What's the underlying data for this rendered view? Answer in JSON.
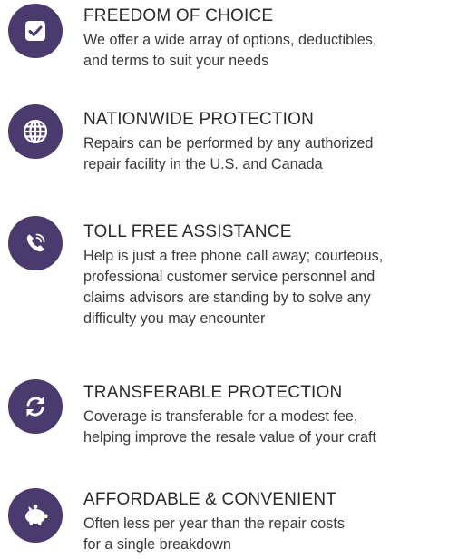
{
  "features": [
    {
      "icon": "checkbox-icon",
      "title": "FREEDOM OF CHOICE",
      "description": "We offer a wide array of options, deductibles,\nand terms to suit your needs"
    },
    {
      "icon": "globe-icon",
      "title": "NATIONWIDE PROTECTION",
      "description": "Repairs can be performed by any authorized\nrepair facility in the U.S. and Canada"
    },
    {
      "icon": "phone-icon",
      "title": "TOLL FREE ASSISTANCE",
      "description": "Help is just a free phone call away; courteous,\nprofessional customer service personnel and\nclaims advisors are standing by to solve any\ndifficulty you may encounter"
    },
    {
      "icon": "transfer-arrows-icon",
      "title": "TRANSFERABLE PROTECTION",
      "description": "Coverage is transferable for a modest fee,\nhelping improve the resale value of your craft"
    },
    {
      "icon": "piggy-bank-icon",
      "title": "AFFORDABLE & CONVENIENT",
      "description": "Often less per year than the repair costs\nfor a single breakdown"
    }
  ],
  "colors": {
    "icon_background": "#4a3a6e",
    "icon_foreground": "#ffffff"
  }
}
